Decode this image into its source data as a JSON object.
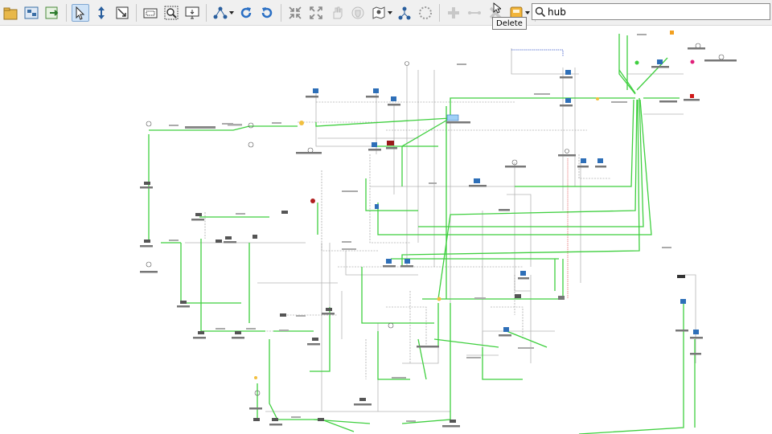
{
  "toolbar": {
    "tooltip_delete": "Delete",
    "buttons": [
      {
        "icon": "node-container-icon"
      },
      {
        "icon": "map-node-icon"
      },
      {
        "icon": "map-export-icon"
      },
      {
        "icon": "select-pointer-icon"
      },
      {
        "icon": "move-vertical-icon"
      },
      {
        "icon": "zoom-box-icon"
      },
      {
        "icon": "fit-to-screen-icon"
      },
      {
        "icon": "zoom-area-icon"
      },
      {
        "icon": "monitor-view-icon"
      },
      {
        "icon": "layout-graph-icon"
      },
      {
        "icon": "rotate-cw-icon"
      },
      {
        "icon": "rotate-ccw-icon"
      },
      {
        "icon": "collapse-icon"
      },
      {
        "icon": "expand-icon"
      },
      {
        "icon": "hand-pan-icon"
      },
      {
        "icon": "hand-grab-icon"
      },
      {
        "icon": "map-shape-icon"
      },
      {
        "icon": "network-link-icon"
      },
      {
        "icon": "dotted-circle-icon"
      },
      {
        "icon": "add-node-icon"
      },
      {
        "icon": "add-link-icon"
      },
      {
        "icon": "delete-icon"
      },
      {
        "icon": "object-group-icon"
      }
    ]
  },
  "search": {
    "value": "hub",
    "placeholder": ""
  },
  "colors": {
    "link_active": "#3fcf3f",
    "link_inactive": "#b5b5b5",
    "link_alert": "#e05050",
    "node_blue": "#2e6fb8",
    "accent_select": "#cfe3f7"
  }
}
